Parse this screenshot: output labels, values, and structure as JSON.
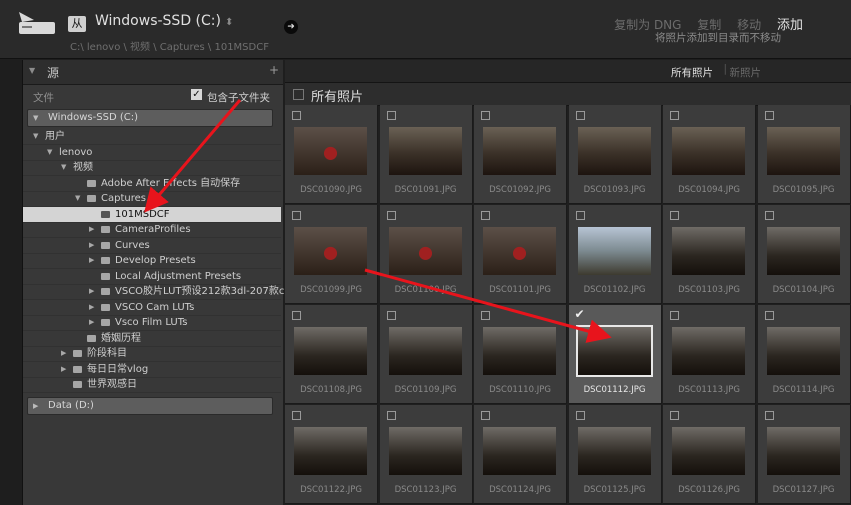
{
  "topbar": {
    "from_label": "从",
    "source_title": "Windows-SSD (C:)",
    "source_path": "C:\\ lenovo \\ 视频 \\ Captures \\ 101MSDCF",
    "modes": [
      {
        "label": "复制为 DNG",
        "active": false
      },
      {
        "label": "复制",
        "active": false
      },
      {
        "label": "移动",
        "active": false
      },
      {
        "label": "添加",
        "active": true
      }
    ],
    "mode_description": "将照片添加到目录而不移动"
  },
  "source_panel": {
    "title": "源",
    "files_label": "文件",
    "include_subfolders_label": "包含子文件夹",
    "include_subfolders_checked": true,
    "drive_c": "Windows-SSD (C:)",
    "drive_d": "Data (D:)",
    "tree": [
      {
        "label": "用户",
        "tri": "▼",
        "folder": false,
        "depth": 0
      },
      {
        "label": "lenovo",
        "tri": "▼",
        "folder": false,
        "depth": 1
      },
      {
        "label": "视频",
        "tri": "▼",
        "folder": false,
        "depth": 2
      },
      {
        "label": "Adobe After Effects 自动保存",
        "tri": "",
        "folder": true,
        "depth": 3
      },
      {
        "label": "Captures",
        "tri": "▼",
        "folder": true,
        "depth": 3
      },
      {
        "label": "101MSDCF",
        "tri": "",
        "folder": true,
        "depth": 4,
        "selected": true
      },
      {
        "label": "CameraProfiles",
        "tri": "▶",
        "folder": true,
        "depth": 4
      },
      {
        "label": "Curves",
        "tri": "▶",
        "folder": true,
        "depth": 4
      },
      {
        "label": "Develop Presets",
        "tri": "▶",
        "folder": true,
        "depth": 4
      },
      {
        "label": "Local Adjustment Presets",
        "tri": "",
        "folder": true,
        "depth": 4
      },
      {
        "label": "VSCO胶片LUT预设212款3dl-207款cub...",
        "tri": "▶",
        "folder": true,
        "depth": 4
      },
      {
        "label": "VSCO Cam LUTs",
        "tri": "▶",
        "folder": true,
        "depth": 4
      },
      {
        "label": "Vsco Film LUTs",
        "tri": "▶",
        "folder": true,
        "depth": 4
      },
      {
        "label": "婚姻历程",
        "tri": "",
        "folder": true,
        "depth": 3
      },
      {
        "label": "阶段科目",
        "tri": "▶",
        "folder": true,
        "depth": 2
      },
      {
        "label": "每日日常vlog",
        "tri": "▶",
        "folder": true,
        "depth": 2
      },
      {
        "label": "世界观感日",
        "tri": "",
        "folder": true,
        "depth": 2
      }
    ]
  },
  "grid": {
    "filter_all": "所有照片",
    "filter_new": "新照片",
    "title": "所有照片",
    "photos": [
      {
        "name": "DSC01090.JPG",
        "style": "red"
      },
      {
        "name": "DSC01091.JPG",
        "style": ""
      },
      {
        "name": "DSC01092.JPG",
        "style": ""
      },
      {
        "name": "DSC01093.JPG",
        "style": ""
      },
      {
        "name": "DSC01094.JPG",
        "style": ""
      },
      {
        "name": "DSC01095.JPG",
        "style": ""
      },
      {
        "name": "DSC01099.JPG",
        "style": "red"
      },
      {
        "name": "DSC01100.JPG",
        "style": "red"
      },
      {
        "name": "DSC01101.JPG",
        "style": "red"
      },
      {
        "name": "DSC01102.JPG",
        "style": "bright"
      },
      {
        "name": "DSC01103.JPG",
        "style": "dark"
      },
      {
        "name": "DSC01104.JPG",
        "style": "dark"
      },
      {
        "name": "DSC01108.JPG",
        "style": "dark"
      },
      {
        "name": "DSC01109.JPG",
        "style": "dark"
      },
      {
        "name": "DSC01110.JPG",
        "style": "dark"
      },
      {
        "name": "DSC01112.JPG",
        "style": "dark",
        "selected": true
      },
      {
        "name": "DSC01113.JPG",
        "style": "dark"
      },
      {
        "name": "DSC01114.JPG",
        "style": "dark"
      },
      {
        "name": "DSC01122.JPG",
        "style": "dark"
      },
      {
        "name": "DSC01123.JPG",
        "style": "dark"
      },
      {
        "name": "DSC01124.JPG",
        "style": "dark"
      },
      {
        "name": "DSC01125.JPG",
        "style": "dark"
      },
      {
        "name": "DSC01126.JPG",
        "style": "dark"
      },
      {
        "name": "DSC01127.JPG",
        "style": "dark"
      }
    ]
  },
  "colors": {
    "annotation_arrow": "#e8141c"
  }
}
